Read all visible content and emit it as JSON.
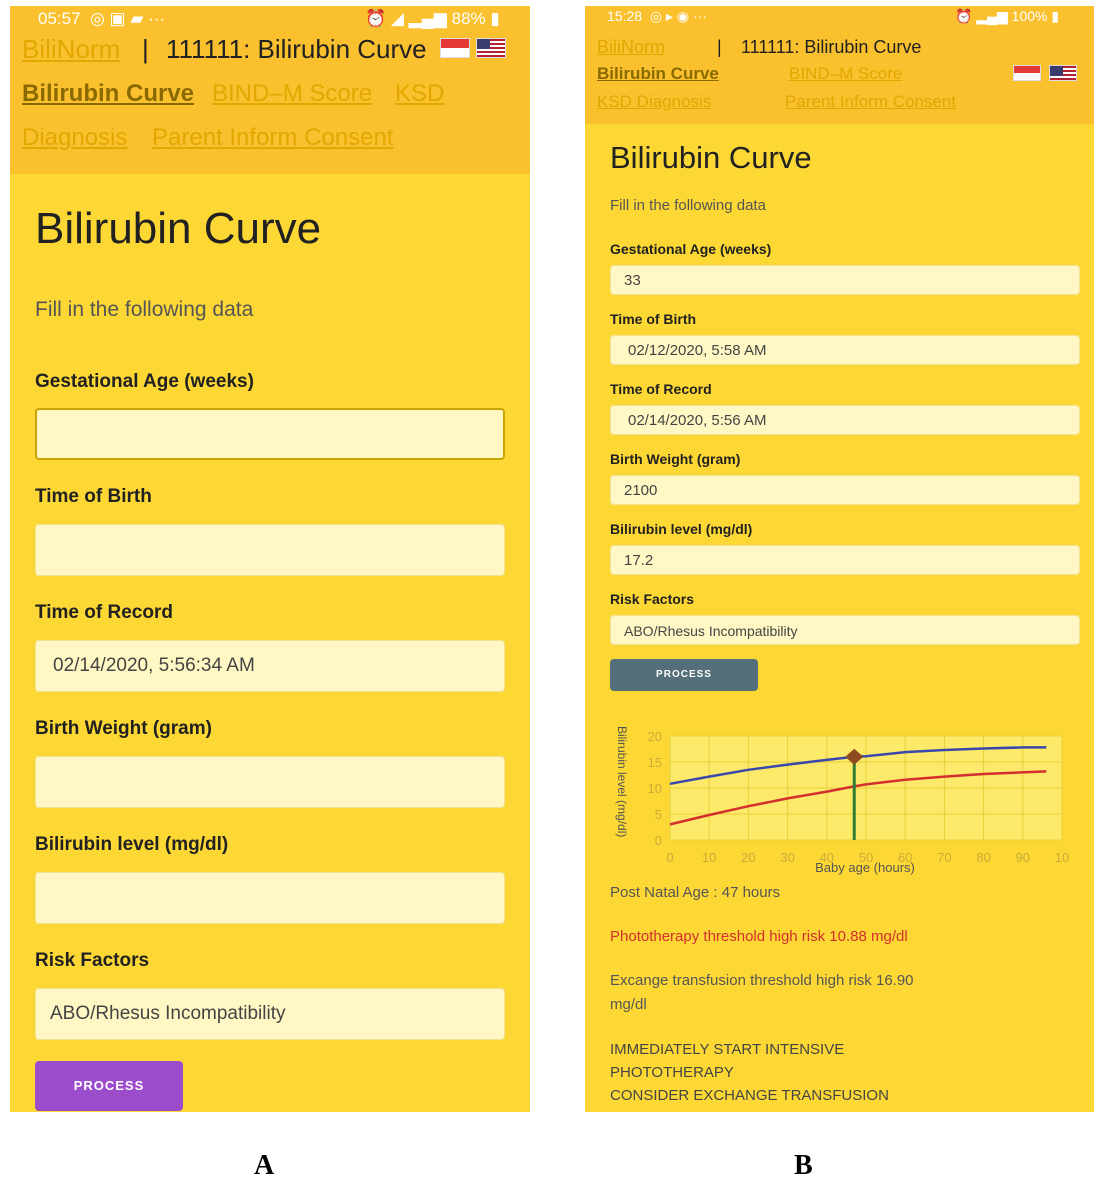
{
  "panelA": {
    "status": {
      "time": "05:57",
      "battery": "88%"
    },
    "nav": {
      "app_name": "BiliNorm",
      "separator": "|",
      "patient_title": "111111: Bilirubin Curve",
      "tab_bilirubin": "Bilirubin Curve",
      "tab_bind": "BIND–M Score",
      "tab_ksd_1": "KSD",
      "tab_ksd_2": "Diagnosis",
      "tab_consent": "Parent Inform Consent"
    },
    "page_title": "Bilirubin Curve",
    "subtitle": "Fill in the following data",
    "fields": [
      {
        "label": "Gestational Age (weeks)",
        "value": ""
      },
      {
        "label": "Time of Birth",
        "value": ""
      },
      {
        "label": "Time of Record",
        "value": "02/14/2020, 5:56:34 AM"
      },
      {
        "label": "Birth Weight (gram)",
        "value": ""
      },
      {
        "label": "Bilirubin level (mg/dl)",
        "value": ""
      },
      {
        "label": "Risk Factors",
        "value": "ABO/Rhesus Incompatibility"
      }
    ],
    "process_label": "PROCESS",
    "caption": "A"
  },
  "panelB": {
    "status": {
      "time": "15:28",
      "battery": "100%"
    },
    "nav": {
      "app_name": "BiliNorm",
      "separator": "|",
      "patient_title": "111111: Bilirubin Curve",
      "tab_bilirubin": "Bilirubin Curve",
      "tab_bind": "BIND–M Score",
      "tab_ksd": "KSD Diagnosis",
      "tab_consent": "Parent Inform Consent"
    },
    "page_title": "Bilirubin Curve",
    "subtitle": "Fill in the following data",
    "fields": [
      {
        "label": "Gestational Age (weeks)",
        "value": "33"
      },
      {
        "label": "Time of Birth",
        "value": "02/12/2020, 5:58 AM"
      },
      {
        "label": "Time of Record",
        "value": "02/14/2020, 5:56 AM"
      },
      {
        "label": "Birth Weight (gram)",
        "value": "2100"
      },
      {
        "label": "Bilirubin level (mg/dl)",
        "value": "17.2"
      },
      {
        "label": "Risk Factors",
        "value": "ABO/Rhesus Incompatibility"
      }
    ],
    "process_label": "PROCESS",
    "post_natal_age": "Post Natal Age : 47 hours",
    "phototherapy": "Phototherapy threshold high risk 10.88 mg/dl",
    "exchange_1": "Excange transfusion threshold high risk 16.90",
    "exchange_2": "mg/dl",
    "advice_1": "IMMEDIATELY START INTENSIVE",
    "advice_2": "PHOTOTHERAPY",
    "advice_3": "CONSIDER EXCHANGE TRANSFUSION",
    "caption": "B"
  },
  "colors": {
    "background": "#fdd835",
    "header": "#fbc02d",
    "process_a": "#9c4dcc",
    "process_b": "#546e7a",
    "exchange_line": "#3949ab",
    "photo_line": "#d32f2f",
    "marker_line": "#2e7d32",
    "marker": "#8d4b1f"
  },
  "chart_data": {
    "type": "line",
    "xlabel": "Baby age (hours)",
    "ylabel": "Bilirubin level (mg/dl)",
    "x_ticks": [
      "0",
      "10",
      "20",
      "30",
      "40",
      "50",
      "60",
      "70",
      "80",
      "90",
      "10"
    ],
    "y_ticks": [
      "20",
      "15",
      "10",
      "5",
      "0"
    ],
    "xlim": [
      0,
      100
    ],
    "ylim": [
      0,
      20
    ],
    "grid": true,
    "series": [
      {
        "x": [
          0,
          10,
          20,
          30,
          40,
          47,
          50,
          60,
          70,
          80,
          90,
          96
        ],
        "values": [
          10.8,
          12.2,
          13.5,
          14.5,
          15.4,
          16.0,
          16.1,
          16.9,
          17.3,
          17.6,
          17.8,
          17.8
        ],
        "color": "#3949ab"
      },
      {
        "x": [
          0,
          10,
          20,
          30,
          40,
          47,
          50,
          60,
          70,
          80,
          90,
          96
        ],
        "values": [
          3.0,
          4.8,
          6.5,
          8.0,
          9.3,
          10.3,
          10.7,
          11.6,
          12.2,
          12.7,
          13.0,
          13.2
        ],
        "color": "#d32f2f"
      }
    ],
    "marker": {
      "x": 47,
      "y": 16.0,
      "color": "#8d4b1f",
      "line_color": "#2e7d32"
    }
  }
}
